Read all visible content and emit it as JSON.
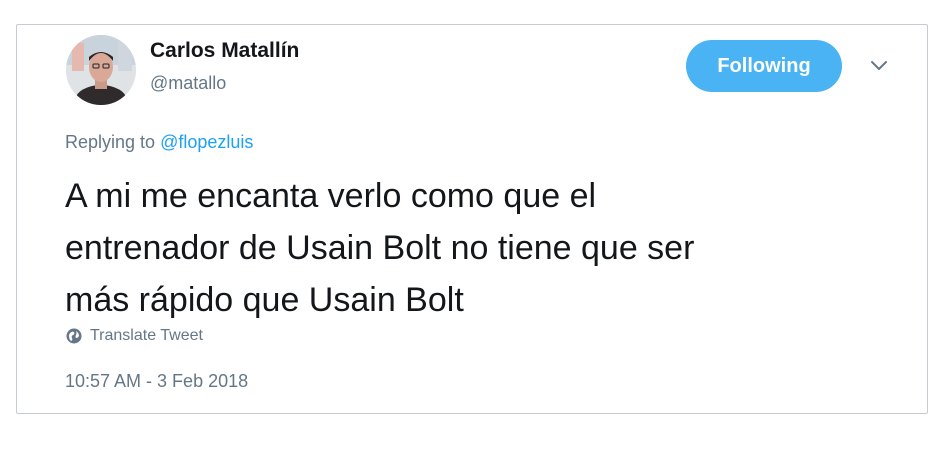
{
  "author": {
    "display_name": "Carlos Matallín",
    "handle": "@matallo"
  },
  "follow_button": {
    "label": "Following",
    "color": "#4ab3f4"
  },
  "menu": {
    "icon": "chevron-down-icon"
  },
  "reply": {
    "prefix": "Replying to ",
    "mention": "@flopezluis"
  },
  "tweet": {
    "lines": [
      "A mi me encanta verlo como que el",
      "entrenador de Usain Bolt no tiene que ser",
      "más rápido que Usain Bolt"
    ]
  },
  "translate": {
    "icon": "globe-icon",
    "label": "Translate Tweet"
  },
  "meta": {
    "timestamp": "10:57 AM - 3 Feb 2018"
  }
}
